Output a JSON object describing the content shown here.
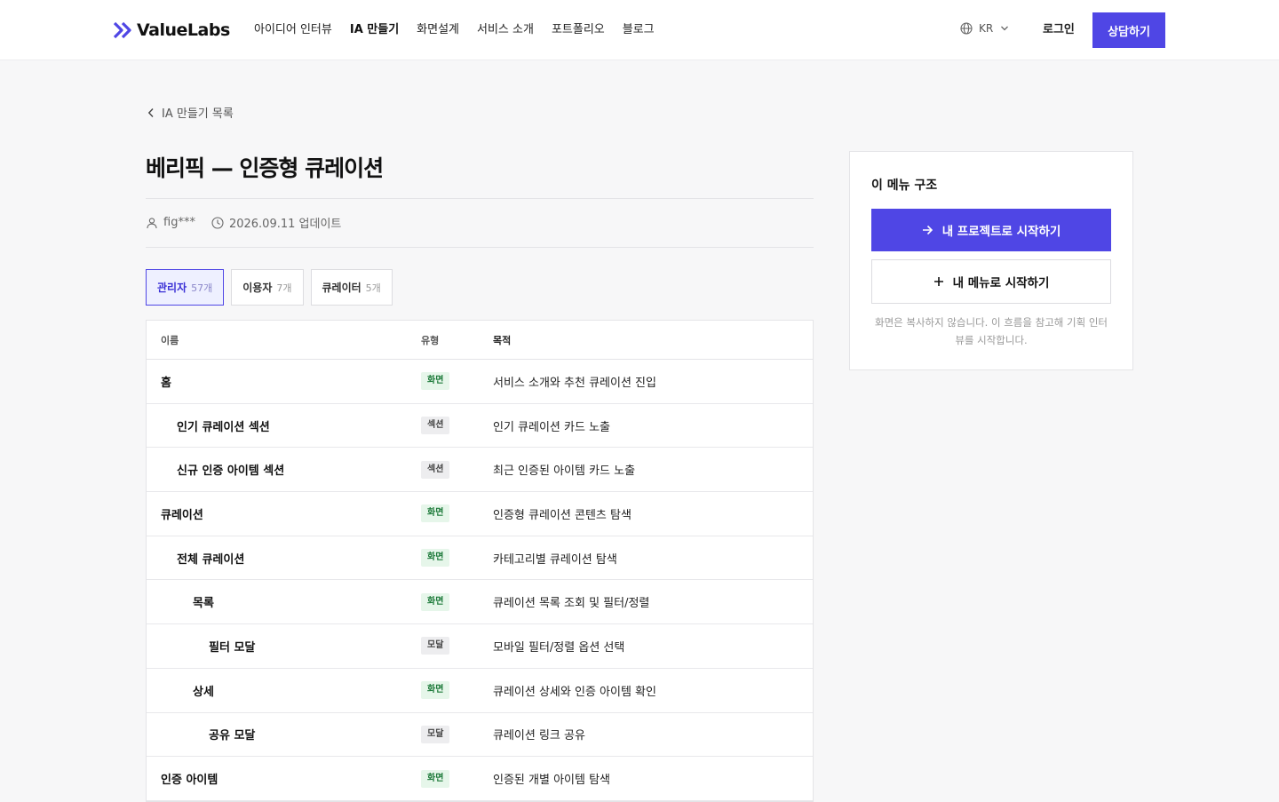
{
  "header": {
    "logo_text": "ValueLabs",
    "nav": [
      {
        "label": "아이디어 인터뷰",
        "active": false
      },
      {
        "label": "IA 만들기",
        "active": true
      },
      {
        "label": "화면설계",
        "active": false
      },
      {
        "label": "서비스 소개",
        "active": false
      },
      {
        "label": "포트폴리오",
        "active": false
      },
      {
        "label": "블로그",
        "active": false
      }
    ],
    "language": "KR",
    "login_label": "로그인",
    "cta_label": "상담하기"
  },
  "breadcrumb": {
    "back_label": "IA 만들기 목록"
  },
  "page": {
    "title": "베리픽 — 인증형 큐레이션",
    "author": "fig***",
    "updated": "2026.09.11 업데이트"
  },
  "tabs": [
    {
      "label": "관리자",
      "count": "57개",
      "active": true
    },
    {
      "label": "이용자",
      "count": "7개",
      "active": false
    },
    {
      "label": "큐레이터",
      "count": "5개",
      "active": false
    }
  ],
  "table": {
    "headers": {
      "name": "이름",
      "type": "유형",
      "purpose": "목적"
    },
    "rows": [
      {
        "name": "홈",
        "level": 0,
        "type": "화면",
        "kind": "screen",
        "purpose": "서비스 소개와 추천 큐레이션 진입"
      },
      {
        "name": "인기 큐레이션 섹션",
        "level": 1,
        "type": "섹션",
        "kind": "section",
        "purpose": "인기 큐레이션 카드 노출"
      },
      {
        "name": "신규 인증 아이템 섹션",
        "level": 1,
        "type": "섹션",
        "kind": "section",
        "purpose": "최근 인증된 아이템 카드 노출"
      },
      {
        "name": "큐레이션",
        "level": 0,
        "type": "화면",
        "kind": "screen",
        "purpose": "인증형 큐레이션 콘텐츠 탐색"
      },
      {
        "name": "전체 큐레이션",
        "level": 1,
        "type": "화면",
        "kind": "screen",
        "purpose": "카테고리별 큐레이션 탐색"
      },
      {
        "name": "목록",
        "level": 2,
        "type": "화면",
        "kind": "screen",
        "purpose": "큐레이션 목록 조회 및 필터/정렬"
      },
      {
        "name": "필터 모달",
        "level": 3,
        "type": "모달",
        "kind": "modal",
        "purpose": "모바일 필터/정렬 옵션 선택"
      },
      {
        "name": "상세",
        "level": 2,
        "type": "화면",
        "kind": "screen",
        "purpose": "큐레이션 상세와 인증 아이템 확인"
      },
      {
        "name": "공유 모달",
        "level": 3,
        "type": "모달",
        "kind": "modal",
        "purpose": "큐레이션 링크 공유"
      },
      {
        "name": "인증 아이템",
        "level": 0,
        "type": "화면",
        "kind": "screen",
        "purpose": "인증된 개별 아이템 탐색"
      }
    ]
  },
  "side_card": {
    "title": "이 메뉴 구조",
    "primary_label": "내 프로젝트로 시작하기",
    "secondary_label": "내 메뉴로 시작하기",
    "note": "화면은 복사하지 않습니다. 이 흐름을 참고해 기획 인터뷰를 시작합니다."
  },
  "colors": {
    "accent": "#4f46e5",
    "screen_badge_bg": "#e6f6ea",
    "screen_badge_text": "#1d7a3a"
  }
}
